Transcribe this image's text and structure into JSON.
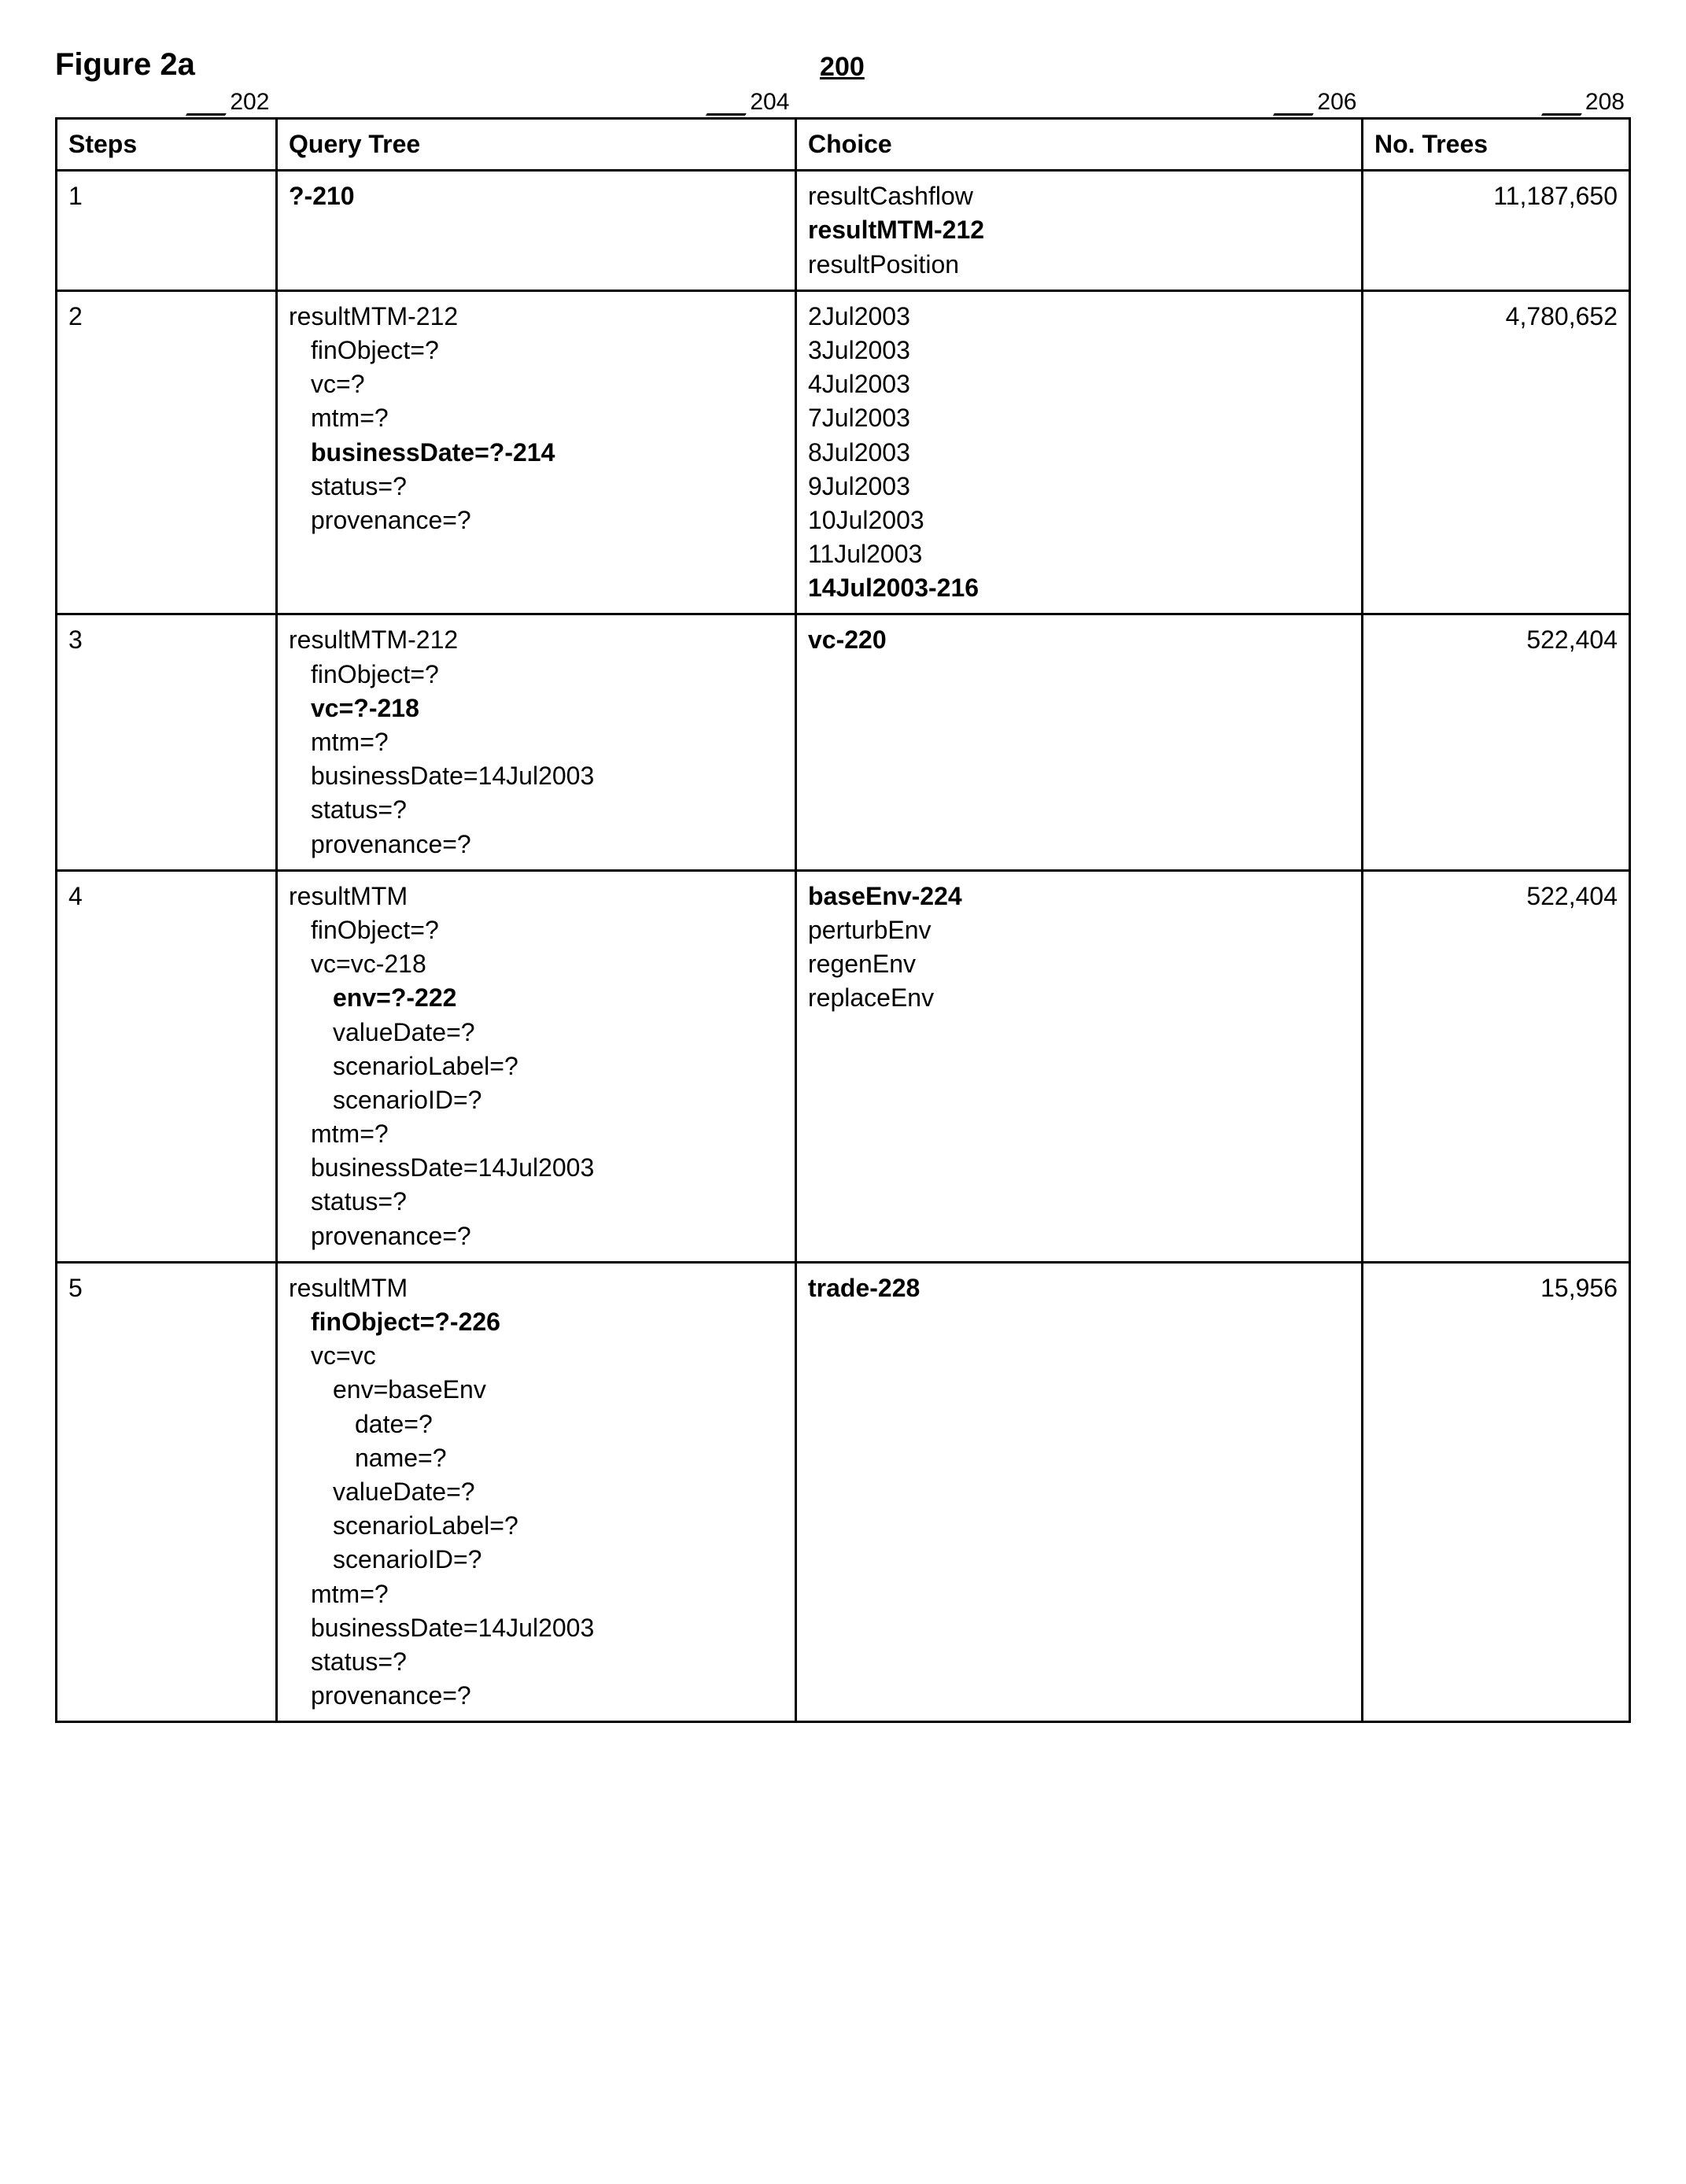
{
  "figure_title": "Figure 2a",
  "figure_number": "200",
  "col_labels": {
    "steps": "202",
    "query": "204",
    "choice": "206",
    "trees": "208"
  },
  "headers": {
    "steps": "Steps",
    "query": "Query Tree",
    "choice": "Choice",
    "trees": "No. Trees"
  },
  "rows": [
    {
      "step": "1",
      "query": [
        {
          "t": "?-210",
          "b": true
        }
      ],
      "choice": [
        {
          "t": "resultCashflow"
        },
        {
          "t": "resultMTM-212",
          "b": true
        },
        {
          "t": "resultPosition"
        }
      ],
      "trees": "11,187,650"
    },
    {
      "step": "2",
      "query": [
        {
          "t": "resultMTM-212"
        },
        {
          "t": "finObject=?",
          "indent": 1
        },
        {
          "t": "vc=?",
          "indent": 1
        },
        {
          "t": "mtm=?",
          "indent": 1
        },
        {
          "t": "businessDate=?-214",
          "indent": 1,
          "b": true
        },
        {
          "t": "status=?",
          "indent": 1
        },
        {
          "t": "provenance=?",
          "indent": 1
        }
      ],
      "choice": [
        {
          "t": "2Jul2003"
        },
        {
          "t": "3Jul2003"
        },
        {
          "t": "4Jul2003"
        },
        {
          "t": "7Jul2003"
        },
        {
          "t": "8Jul2003"
        },
        {
          "t": "9Jul2003"
        },
        {
          "t": "10Jul2003"
        },
        {
          "t": "11Jul2003"
        },
        {
          "t": "14Jul2003-216",
          "b": true
        }
      ],
      "trees": "4,780,652"
    },
    {
      "step": "3",
      "query": [
        {
          "t": "resultMTM-212"
        },
        {
          "t": "finObject=?",
          "indent": 1
        },
        {
          "t": "vc=?-218",
          "indent": 1,
          "b": true
        },
        {
          "t": "mtm=?",
          "indent": 1
        },
        {
          "t": "businessDate=14Jul2003",
          "indent": 1
        },
        {
          "t": "status=?",
          "indent": 1
        },
        {
          "t": "provenance=?",
          "indent": 1
        }
      ],
      "choice": [
        {
          "t": "vc-220",
          "b": true
        }
      ],
      "trees": "522,404"
    },
    {
      "step": "4",
      "query": [
        {
          "t": "resultMTM"
        },
        {
          "t": "finObject=?",
          "indent": 1
        },
        {
          "t": "vc=vc-218",
          "indent": 1
        },
        {
          "t": "env=?-222",
          "indent": 2,
          "b": true
        },
        {
          "t": "valueDate=?",
          "indent": 2
        },
        {
          "t": "scenarioLabel=?",
          "indent": 2
        },
        {
          "t": "scenarioID=?",
          "indent": 2
        },
        {
          "t": "mtm=?",
          "indent": 1
        },
        {
          "t": "businessDate=14Jul2003",
          "indent": 1
        },
        {
          "t": "status=?",
          "indent": 1
        },
        {
          "t": "provenance=?",
          "indent": 1
        }
      ],
      "choice": [
        {
          "t": "baseEnv-224",
          "b": true
        },
        {
          "t": "perturbEnv"
        },
        {
          "t": "regenEnv"
        },
        {
          "t": "replaceEnv"
        }
      ],
      "trees": "522,404"
    },
    {
      "step": "5",
      "query": [
        {
          "t": "resultMTM"
        },
        {
          "t": "finObject=?-226",
          "indent": 1,
          "b": true
        },
        {
          "t": "vc=vc",
          "indent": 1
        },
        {
          "t": "env=baseEnv",
          "indent": 2
        },
        {
          "t": "date=?",
          "indent": 3
        },
        {
          "t": "name=?",
          "indent": 3
        },
        {
          "t": "valueDate=?",
          "indent": 2
        },
        {
          "t": "scenarioLabel=?",
          "indent": 2
        },
        {
          "t": "scenarioID=?",
          "indent": 2
        },
        {
          "t": "mtm=?",
          "indent": 1
        },
        {
          "t": "businessDate=14Jul2003",
          "indent": 1
        },
        {
          "t": "status=?",
          "indent": 1
        },
        {
          "t": "provenance=?",
          "indent": 1
        }
      ],
      "choice": [
        {
          "t": "trade-228",
          "b": true
        }
      ],
      "trees": "15,956"
    }
  ]
}
